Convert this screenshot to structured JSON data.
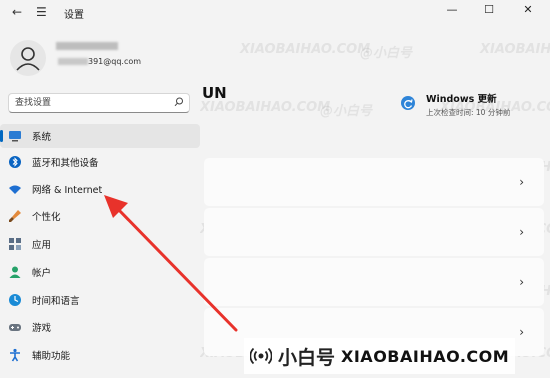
{
  "window": {
    "title": "设置",
    "back_icon": "←",
    "menu_icon": "☰",
    "minimize": "—",
    "maximize": "☐",
    "close": "✕"
  },
  "account": {
    "email_suffix": "391@qq.com"
  },
  "search": {
    "placeholder": "查找设置"
  },
  "sidebar": {
    "items": [
      {
        "label": "系统",
        "icon": "monitor-icon",
        "color": "#2b7cd3",
        "selected": true
      },
      {
        "label": "蓝牙和其他设备",
        "icon": "bluetooth-icon",
        "color": "#0a64c2"
      },
      {
        "label": "网络 & Internet",
        "icon": "wifi-icon",
        "color": "#1e6fd1"
      },
      {
        "label": "个性化",
        "icon": "brush-icon",
        "color": "#e38a3c"
      },
      {
        "label": "应用",
        "icon": "apps-icon",
        "color": "#5a6e86"
      },
      {
        "label": "帐户",
        "icon": "person-icon",
        "color": "#26a269"
      },
      {
        "label": "时间和语言",
        "icon": "globe-clock-icon",
        "color": "#1a8bd6"
      },
      {
        "label": "游戏",
        "icon": "gamepad-icon",
        "color": "#6a7480"
      },
      {
        "label": "辅助功能",
        "icon": "accessibility-icon",
        "color": "#1e6fd1"
      }
    ]
  },
  "main": {
    "heading": "UN",
    "update": {
      "title": "Windows 更新",
      "subtitle": "上次检查时间: 10 分钟前"
    },
    "card_chevron": "›"
  },
  "watermark": {
    "cn": "@小白号",
    "en": "XIAOBAIHAO.COM"
  },
  "logo": {
    "cn": "小白号",
    "en": "XIAOBAIHAO.COM"
  },
  "colors": {
    "accent": "#0067c0",
    "arrow": "#e8322b"
  }
}
